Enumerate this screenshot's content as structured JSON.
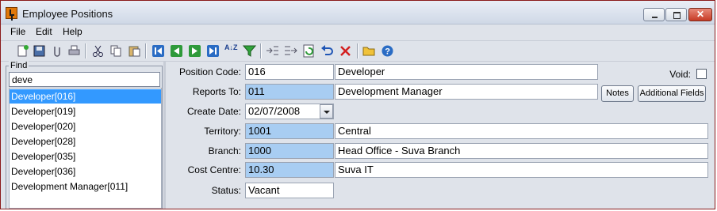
{
  "window": {
    "title": "Employee Positions",
    "close_glyph": "✕"
  },
  "menu": {
    "items": [
      "File",
      "Edit",
      "Help"
    ]
  },
  "toolbar": {
    "icons": [
      "new-record-icon",
      "save-icon",
      "attach-icon",
      "print-icon",
      "cut-icon",
      "copy-icon",
      "paste-icon",
      "first-record-icon",
      "previous-record-icon",
      "next-record-icon",
      "last-record-icon",
      "sort-az-icon",
      "filter-icon",
      "outdent-icon",
      "indent-icon",
      "refresh-icon",
      "undo-icon",
      "delete-icon",
      "open-folder-icon",
      "help-icon"
    ],
    "sort_glyph": "A↓Z"
  },
  "find": {
    "label": "Find",
    "value": "deve",
    "results": [
      {
        "label": "Developer[016]",
        "selected": true
      },
      {
        "label": "Developer[019]",
        "selected": false
      },
      {
        "label": "Developer[020]",
        "selected": false
      },
      {
        "label": "Developer[028]",
        "selected": false
      },
      {
        "label": "Developer[035]",
        "selected": false
      },
      {
        "label": "Developer[036]",
        "selected": false
      },
      {
        "label": "Development Manager[011]",
        "selected": false
      }
    ]
  },
  "form": {
    "position_code": {
      "label": "Position Code:",
      "code": "016",
      "description": "Developer"
    },
    "void": {
      "label": "Void:",
      "checked": false
    },
    "reports_to": {
      "label": "Reports To:",
      "code": "011",
      "description": "Development Manager"
    },
    "notes_button": "Notes",
    "additional_fields_button": "Additional Fields",
    "create_date": {
      "label": "Create Date:",
      "value": "02/07/2008"
    },
    "territory": {
      "label": "Territory:",
      "code": "1001",
      "description": "Central"
    },
    "branch": {
      "label": "Branch:",
      "code": "1000",
      "description": "Head Office - Suva Branch"
    },
    "cost_centre": {
      "label": "Cost Centre:",
      "code": "10.30",
      "description": "Suva IT"
    },
    "status": {
      "label": "Status:",
      "value": "Vacant"
    }
  },
  "colors": {
    "lookup_field": "#a8cdf2",
    "selection": "#3399ff",
    "window_border": "#8a1a1a"
  }
}
